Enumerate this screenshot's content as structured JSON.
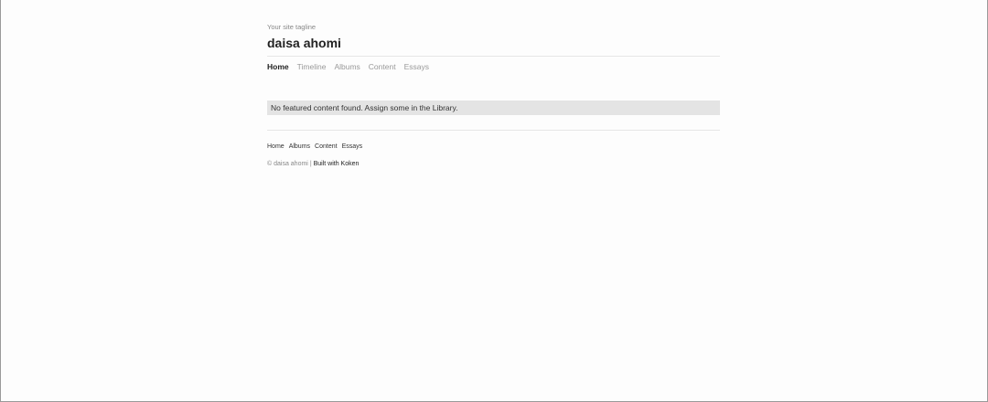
{
  "header": {
    "tagline": "Your site tagline",
    "title": "daisa ahomi"
  },
  "nav": [
    {
      "label": "Home",
      "active": true
    },
    {
      "label": "Timeline"
    },
    {
      "label": "Albums"
    },
    {
      "label": "Content"
    },
    {
      "label": "Essays"
    }
  ],
  "notice": "No featured content found. Assign some in the Library.",
  "footer": {
    "nav": [
      "Home",
      "Albums",
      "Content",
      "Essays"
    ],
    "copyright": "© daisa ahomi",
    "separator": "|",
    "built_with": "Built with Koken"
  }
}
